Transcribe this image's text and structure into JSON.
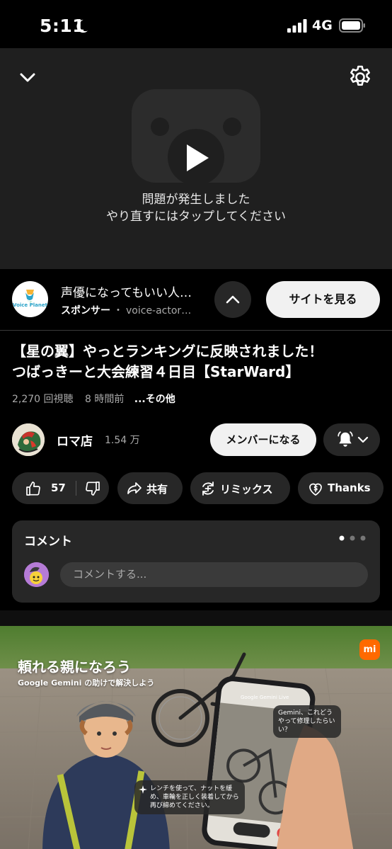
{
  "status_bar": {
    "time": "5:11",
    "network": "4G"
  },
  "player": {
    "error_line1": "問題が発生しました",
    "error_line2": "やり直すにはタップしてください"
  },
  "ad": {
    "logo_text": "Voice Planet",
    "title": "声優になってもいい人…",
    "sponsor_label": "スポンサー",
    "separator": "・",
    "domain": "voice-actor…",
    "cta": "サイトを見る"
  },
  "video": {
    "title_line1": "【星の翼】やっとランキングに反映されました！",
    "title_line2": "つばっきーと大会練習４日目【StarWard】",
    "views": "2,270 回視聴",
    "age": "8 時間前",
    "more": "...その他"
  },
  "channel": {
    "name": "ロマ店",
    "subscribers": "1.54 万",
    "join_label": "メンバーになる"
  },
  "actions": {
    "likes": "57",
    "share": "共有",
    "remix": "リミックス",
    "thanks": "Thanks"
  },
  "comments": {
    "title": "コメント",
    "placeholder": "コメントする..."
  },
  "banner": {
    "headline": "頼れる親になろう",
    "sub": "Google Gemini の助けで解決しよう",
    "logo": "mi",
    "phone_title": "Google Gemini Live",
    "bubble1": "Gemini、これどうやって修理したらいい？",
    "bubble2": "レンチを使って、ナットを緩め、車輪を正しく装着してから再び締めてください。"
  },
  "colors": {
    "background": "#000000",
    "player_bg": "#1f1f1f",
    "pill_bg": "#272727",
    "button_light": "#f1f1f1",
    "secondary_text": "#aaaaaa"
  }
}
